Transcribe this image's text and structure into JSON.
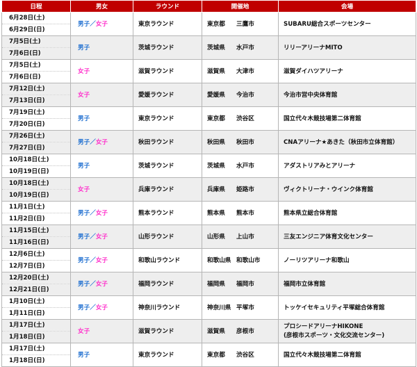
{
  "headers": [
    "日程",
    "男女",
    "ラウンド",
    "開催地",
    "会場"
  ],
  "gender_separator": "／",
  "colors": {
    "header_bg": "#c00000",
    "boy": "#1f6fd0",
    "girl": "#ff33cc",
    "shade": "#eeeeee"
  },
  "rows": [
    {
      "date1": "6月28日(土)",
      "date2": "6月29日(日)",
      "boy": "男子",
      "girl": "女子",
      "round": "東京ラウンド",
      "pref": "東京都",
      "city": "三鷹市",
      "venue": "SUBARU総合スポーツセンター",
      "venue2": ""
    },
    {
      "date1": "7月5日(土)",
      "date2": "7月6日(日)",
      "boy": "男子",
      "girl": "",
      "round": "茨城ラウンド",
      "pref": "茨城県",
      "city": "水戸市",
      "venue": "リリーアリーナMITO",
      "venue2": ""
    },
    {
      "date1": "7月5日(土)",
      "date2": "7月6日(日)",
      "boy": "",
      "girl": "女子",
      "round": "滋賀ラウンド",
      "pref": "滋賀県",
      "city": "大津市",
      "venue": "滋賀ダイハツアリーナ",
      "venue2": ""
    },
    {
      "date1": "7月12日(土)",
      "date2": "7月13日(日)",
      "boy": "",
      "girl": "女子",
      "round": "愛媛ラウンド",
      "pref": "愛媛県",
      "city": "今治市",
      "venue": "今治市営中央体育館",
      "venue2": ""
    },
    {
      "date1": "7月19日(土)",
      "date2": "7月20日(日)",
      "boy": "男子",
      "girl": "",
      "round": "東京ラウンド",
      "pref": "東京都",
      "city": "渋谷区",
      "venue": "国立代々木競技場第二体育館",
      "venue2": ""
    },
    {
      "date1": "7月26日(土)",
      "date2": "7月27日(日)",
      "boy": "男子",
      "girl": "女子",
      "round": "秋田ラウンド",
      "pref": "秋田県",
      "city": "秋田市",
      "venue": "CNAアリーナ★あきた（秋田市立体育館）",
      "venue2": ""
    },
    {
      "date1": "10月18日(土)",
      "date2": "10月19日(日)",
      "boy": "男子",
      "girl": "",
      "round": "茨城ラウンド",
      "pref": "茨城県",
      "city": "水戸市",
      "venue": "アダストリアみとアリーナ",
      "venue2": ""
    },
    {
      "date1": "10月18日(土)",
      "date2": "10月19日(日)",
      "boy": "",
      "girl": "女子",
      "round": "兵庫ラウンド",
      "pref": "兵庫県",
      "city": "姫路市",
      "venue": "ヴィクトリーナ・ウインク体育館",
      "venue2": ""
    },
    {
      "date1": "11月1日(土)",
      "date2": "11月2日(日)",
      "boy": "男子",
      "girl": "女子",
      "round": "熊本ラウンド",
      "pref": "熊本県",
      "city": "熊本市",
      "venue": "熊本県立総合体育館",
      "venue2": ""
    },
    {
      "date1": "11月15日(土)",
      "date2": "11月16日(日)",
      "boy": "男子",
      "girl": "女子",
      "round": "山形ラウンド",
      "pref": "山形県",
      "city": "上山市",
      "venue": "三友エンジニア体育文化センター",
      "venue2": ""
    },
    {
      "date1": "12月6日(土)",
      "date2": "12月7日(日)",
      "boy": "男子",
      "girl": "女子",
      "round": "和歌山ラウンド",
      "pref": "和歌山県",
      "city": "和歌山市",
      "venue": "ノーリツアリーナ和歌山",
      "venue2": ""
    },
    {
      "date1": "12月20日(土)",
      "date2": "12月21日(日)",
      "boy": "男子",
      "girl": "女子",
      "round": "福岡ラウンド",
      "pref": "福岡県",
      "city": "福岡市",
      "venue": "福岡市立体育館",
      "venue2": ""
    },
    {
      "date1": "1月10日(土)",
      "date2": "1月11日(日)",
      "boy": "男子",
      "girl": "女子",
      "round": "神奈川ラウンド",
      "pref": "神奈川県",
      "city": "平塚市",
      "venue": "トッケイセキュリティ平塚総合体育館",
      "venue2": ""
    },
    {
      "date1": "1月17日(土)",
      "date2": "1月18日(日)",
      "boy": "",
      "girl": "女子",
      "round": "滋賀ラウンド",
      "pref": "滋賀県",
      "city": "彦根市",
      "venue": "プロシードアリーナHIKONE",
      "venue2": "(彦根市スポーツ・文化交流センター)"
    },
    {
      "date1": "1月17日(土)",
      "date2": "1月18日(日)",
      "boy": "男子",
      "girl": "",
      "round": "東京ラウンド",
      "pref": "東京都",
      "city": "渋谷区",
      "venue": "国立代々木競技場第二体育館",
      "venue2": ""
    }
  ]
}
